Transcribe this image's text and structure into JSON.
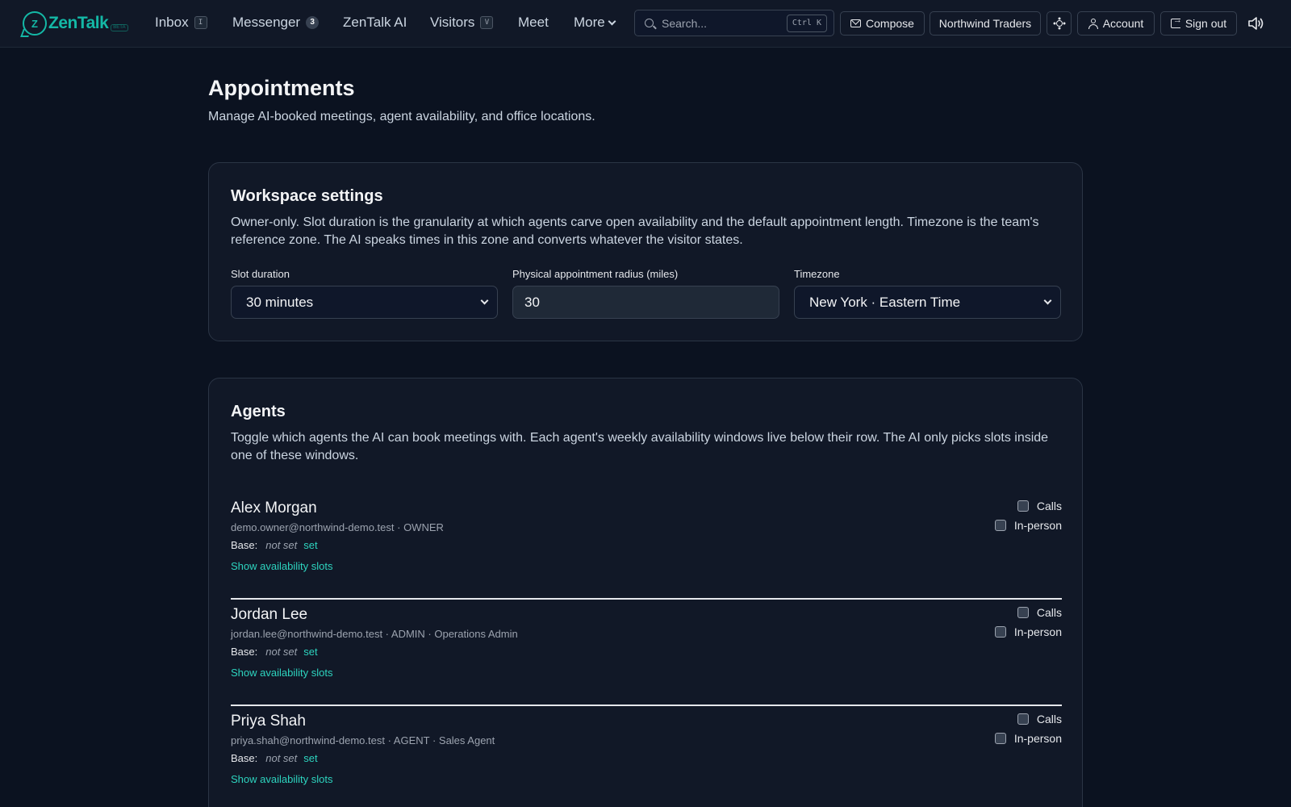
{
  "app": {
    "name": "ZenTalk",
    "logo_letter": "Z",
    "logo_badge": "BETA"
  },
  "nav": {
    "items": [
      {
        "label": "Inbox",
        "badge": "I",
        "badge_type": "kbd"
      },
      {
        "label": "Messenger",
        "badge": "3",
        "badge_type": "count"
      },
      {
        "label": "ZenTalk AI",
        "badge": "",
        "badge_type": "none"
      },
      {
        "label": "Visitors",
        "badge": "V",
        "badge_type": "kbd"
      },
      {
        "label": "Meet",
        "badge": "",
        "badge_type": "none"
      },
      {
        "label": "More",
        "badge": "",
        "badge_type": "dropdown"
      }
    ],
    "search": {
      "placeholder": "Search...",
      "shortcut": "Ctrl K"
    },
    "compose_label": "Compose",
    "workspace_label": "Northwind Traders",
    "account_label": "Account",
    "signout_label": "Sign out"
  },
  "page": {
    "title": "Appointments",
    "subtitle": "Manage AI-booked meetings, agent availability, and office locations."
  },
  "workspace": {
    "title": "Workspace settings",
    "description": "Owner-only. Slot duration is the granularity at which agents carve open availability and the default appointment length. Timezone is the team's reference zone. The AI speaks times in this zone and converts whatever the visitor states.",
    "slot_duration": {
      "label": "Slot duration",
      "value": "30 minutes"
    },
    "radius": {
      "label": "Physical appointment radius (miles)",
      "value": "30"
    },
    "timezone": {
      "label": "Timezone",
      "value": "New York · Eastern Time"
    }
  },
  "agents_section": {
    "title": "Agents",
    "description": "Toggle which agents the AI can book meetings with. Each agent's weekly availability windows live below their row. The AI only picks slots inside one of these windows.",
    "base_label": "Base:",
    "not_set_label": "not set",
    "set_label": "set",
    "show_slots_label": "Show availability slots",
    "calls_label": "Calls",
    "inperson_label": "In-person",
    "agents": [
      {
        "name": "Alex Morgan",
        "meta": "demo.owner@northwind-demo.test · OWNER",
        "calls": false,
        "in_person": false
      },
      {
        "name": "Jordan Lee",
        "meta": "jordan.lee@northwind-demo.test · ADMIN · Operations Admin",
        "calls": false,
        "in_person": false
      },
      {
        "name": "Priya Shah",
        "meta": "priya.shah@northwind-demo.test · AGENT · Sales Agent",
        "calls": false,
        "in_person": false
      }
    ]
  },
  "colors": {
    "background": "#0b1220",
    "surface": "#111827",
    "accent": "#14b8a6",
    "link": "#2dd4bf"
  }
}
